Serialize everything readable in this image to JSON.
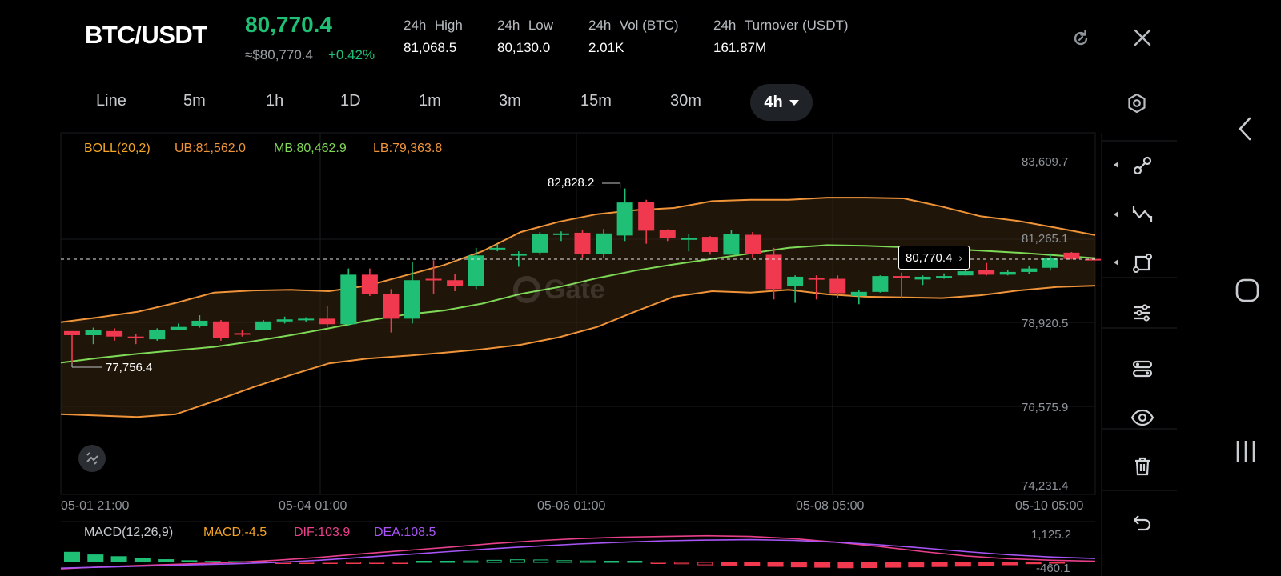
{
  "header": {
    "pair": "BTC/USDT",
    "price": "80,770.4",
    "approx_price": "≈$80,770.4",
    "change": "+0.42%",
    "stats": [
      {
        "label_a": "24h",
        "label_b": "High",
        "value": "81,068.5"
      },
      {
        "label_a": "24h",
        "label_b": "Low",
        "value": "80,130.0"
      },
      {
        "label_a": "24h",
        "label_b": "Vol (BTC)",
        "value": "2.01K"
      },
      {
        "label_a": "24h",
        "label_b": "Turnover (USDT)",
        "value": "161.87M"
      }
    ],
    "refresh_icon": "refresh-icon",
    "close_icon": "close-icon"
  },
  "timeframes": {
    "items": [
      "Line",
      "5m",
      "1h",
      "1D",
      "1m",
      "3m",
      "15m",
      "30m"
    ],
    "active": "4h",
    "settings_icon": "hexagon-settings-icon"
  },
  "indicators": {
    "boll_name": "BOLL(20,2)",
    "ub": "UB:81,562.0",
    "mb": "MB:80,462.9",
    "lb": "LB:79,363.8",
    "macd_name": "MACD(12,26,9)",
    "macd": "MACD:-4.5",
    "dif": "DIF:103.9",
    "dea": "DEA:108.5"
  },
  "price_axis": {
    "labels": [
      "83,609.7",
      "81,265.1",
      "78,920.5",
      "76,575.9",
      "74,231.4"
    ],
    "macd_labels": [
      "1,125.2",
      "-460.1"
    ]
  },
  "time_axis": {
    "labels": [
      "05-01 21:00",
      "05-04 01:00",
      "05-06 01:00",
      "05-08 05:00",
      "05-10 05:00"
    ]
  },
  "annotations": {
    "high_marker": "82,828.2",
    "low_marker": "77,756.4",
    "last_price_tag": "80,770.4"
  },
  "toolbar": {
    "tools": [
      "node-link-icon",
      "zigzag-icon",
      "shape-icon",
      "sliders-icon",
      "link-toggle-icon",
      "eye-icon",
      "trash-icon",
      "undo-icon"
    ]
  },
  "system_nav": {
    "icons": [
      "back-icon",
      "home-icon",
      "recents-icon"
    ]
  },
  "colors": {
    "up": "#1fbf75",
    "down": "#f0394f",
    "ub": "#f0943a",
    "mb": "#7ed957",
    "dif": "#e8408a",
    "dea": "#a855f7",
    "accent_yellow": "#f5a623"
  },
  "chart_data": {
    "type": "candlestick",
    "y_range": [
      74231.4,
      83609.7
    ],
    "candles": [
      {
        "o": 78680,
        "h": 78680,
        "l": 77756.4,
        "c": 78560
      },
      {
        "o": 78560,
        "h": 78780,
        "l": 78300,
        "c": 78720
      },
      {
        "o": 78680,
        "h": 78760,
        "l": 78400,
        "c": 78520
      },
      {
        "o": 78520,
        "h": 78600,
        "l": 78300,
        "c": 78480
      },
      {
        "o": 78440,
        "h": 78760,
        "l": 78400,
        "c": 78720
      },
      {
        "o": 78720,
        "h": 78900,
        "l": 78700,
        "c": 78800
      },
      {
        "o": 78820,
        "h": 79140,
        "l": 78780,
        "c": 78980
      },
      {
        "o": 78960,
        "h": 79000,
        "l": 78400,
        "c": 78480
      },
      {
        "o": 78620,
        "h": 78720,
        "l": 78520,
        "c": 78600
      },
      {
        "o": 78700,
        "h": 79000,
        "l": 78700,
        "c": 78960
      },
      {
        "o": 78960,
        "h": 79100,
        "l": 78900,
        "c": 79020
      },
      {
        "o": 79020,
        "h": 79080,
        "l": 78960,
        "c": 79040
      },
      {
        "o": 79040,
        "h": 79400,
        "l": 78800,
        "c": 78880
      },
      {
        "o": 78880,
        "h": 80500,
        "l": 78820,
        "c": 80320
      },
      {
        "o": 80320,
        "h": 80500,
        "l": 79700,
        "c": 79760
      },
      {
        "o": 79760,
        "h": 79900,
        "l": 78640,
        "c": 79040
      },
      {
        "o": 79040,
        "h": 80700,
        "l": 78900,
        "c": 80160
      },
      {
        "o": 80200,
        "h": 80740,
        "l": 79760,
        "c": 80180
      },
      {
        "o": 80160,
        "h": 80340,
        "l": 79840,
        "c": 80000
      },
      {
        "o": 80000,
        "h": 81100,
        "l": 79900,
        "c": 80880
      },
      {
        "o": 81100,
        "h": 81200,
        "l": 81000,
        "c": 81100
      },
      {
        "o": 80900,
        "h": 81000,
        "l": 80550,
        "c": 80920
      },
      {
        "o": 80960,
        "h": 81560,
        "l": 80900,
        "c": 81500
      },
      {
        "o": 81520,
        "h": 81580,
        "l": 81300,
        "c": 81520
      },
      {
        "o": 81540,
        "h": 81620,
        "l": 80800,
        "c": 80920
      },
      {
        "o": 80920,
        "h": 81650,
        "l": 80800,
        "c": 81520
      },
      {
        "o": 81460,
        "h": 82828.2,
        "l": 81300,
        "c": 82420
      },
      {
        "o": 82440,
        "h": 82500,
        "l": 81220,
        "c": 81600
      },
      {
        "o": 81620,
        "h": 81640,
        "l": 81300,
        "c": 81380
      },
      {
        "o": 81380,
        "h": 81500,
        "l": 81000,
        "c": 81380
      },
      {
        "o": 81420,
        "h": 81440,
        "l": 80900,
        "c": 80980
      },
      {
        "o": 80900,
        "h": 81620,
        "l": 80900,
        "c": 81500
      },
      {
        "o": 81480,
        "h": 81560,
        "l": 80800,
        "c": 80920
      },
      {
        "o": 80900,
        "h": 81100,
        "l": 79600,
        "c": 79900
      },
      {
        "o": 80000,
        "h": 80300,
        "l": 79500,
        "c": 80260
      },
      {
        "o": 80220,
        "h": 80300,
        "l": 79600,
        "c": 80200
      },
      {
        "o": 80200,
        "h": 80300,
        "l": 79650,
        "c": 79780
      },
      {
        "o": 79700,
        "h": 79880,
        "l": 79460,
        "c": 79820
      },
      {
        "o": 79820,
        "h": 80300,
        "l": 79800,
        "c": 80280
      },
      {
        "o": 80280,
        "h": 80380,
        "l": 79640,
        "c": 80240
      },
      {
        "o": 80180,
        "h": 80300,
        "l": 80020,
        "c": 80260
      },
      {
        "o": 80260,
        "h": 80360,
        "l": 80200,
        "c": 80280
      },
      {
        "o": 80300,
        "h": 80500,
        "l": 80300,
        "c": 80420
      },
      {
        "o": 80460,
        "h": 80660,
        "l": 80300,
        "c": 80320
      },
      {
        "o": 80320,
        "h": 80460,
        "l": 80300,
        "c": 80400
      },
      {
        "o": 80400,
        "h": 80560,
        "l": 80340,
        "c": 80500
      },
      {
        "o": 80520,
        "h": 80940,
        "l": 80440,
        "c": 80800
      },
      {
        "o": 80960,
        "h": 80980,
        "l": 80760,
        "c": 80780
      },
      {
        "o": 80780,
        "h": 80800,
        "l": 80740,
        "c": 80770.4
      }
    ],
    "upper_band": [
      78940,
      79080,
      79240,
      79500,
      79800,
      79860,
      79880,
      79840,
      80000,
      80300,
      80600,
      81000,
      81560,
      81860,
      82080,
      82200,
      82260,
      82460,
      82500,
      82500,
      82560,
      82560,
      82540,
      82300,
      82020,
      81880,
      81680,
      81470
    ],
    "middle_band": [
      77760,
      77900,
      78020,
      78120,
      78220,
      78380,
      78560,
      78760,
      78980,
      79160,
      79280,
      79480,
      79760,
      79960,
      80220,
      80440,
      80620,
      80780,
      80940,
      81100,
      81180,
      81160,
      81120,
      81080,
      81020,
      80960,
      80880,
      80800
    ],
    "lower_band": [
      76260,
      76220,
      76180,
      76260,
      76640,
      77040,
      77400,
      77740,
      77880,
      77960,
      78050,
      78150,
      78280,
      78500,
      78800,
      79250,
      79680,
      79840,
      79800,
      79880,
      79750,
      79680,
      79660,
      79640,
      79720,
      79860,
      79960,
      80000
    ],
    "macd_histogram": [
      60,
      45,
      35,
      25,
      18,
      12,
      8,
      5,
      3,
      -2,
      -4,
      -6,
      -6,
      -5,
      -3,
      2,
      5,
      8,
      12,
      15,
      14,
      10,
      8,
      5,
      2,
      -2,
      -8,
      -14,
      -18,
      -22,
      -25,
      -28,
      -30,
      -33,
      -32,
      -30,
      -28,
      -26,
      -24,
      -20,
      -16,
      -10,
      -5
    ],
    "dif": [
      -180,
      -120,
      -80,
      -40,
      0,
      60,
      140,
      240,
      330,
      420,
      520,
      600,
      660,
      700,
      720,
      740,
      720,
      660,
      560,
      440,
      300,
      180,
      100,
      60,
      30
    ],
    "dea": [
      -160,
      -130,
      -100,
      -70,
      -40,
      0,
      60,
      140,
      220,
      300,
      380,
      450,
      510,
      560,
      600,
      620,
      630,
      610,
      560,
      490,
      400,
      300,
      210,
      150,
      108.5
    ]
  }
}
